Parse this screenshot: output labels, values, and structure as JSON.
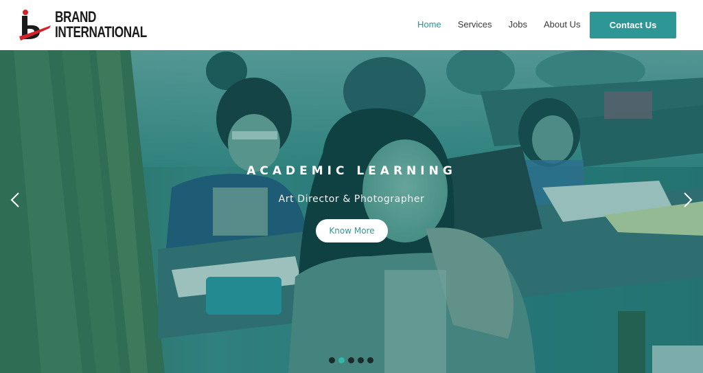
{
  "brand": {
    "line1": "BRAND",
    "line2": "INTERNATIONAL",
    "mark_color": "#d2232a",
    "text_color": "#1a1a1a"
  },
  "nav": {
    "items": [
      {
        "label": "Home",
        "active": true
      },
      {
        "label": "Services",
        "active": false
      },
      {
        "label": "Jobs",
        "active": false
      },
      {
        "label": "About Us",
        "active": false
      }
    ],
    "contact_label": "Contact Us",
    "accent_color": "#2e9795"
  },
  "hero": {
    "title": "ACADEMIC LEARNING",
    "subtitle": "Art Director & Photographer",
    "button_label": "Know More",
    "overlay_color": "#1f7f7c",
    "prev_icon": "chevron-left-icon",
    "next_icon": "chevron-right-icon",
    "slides_total": 5,
    "active_slide": 2
  }
}
